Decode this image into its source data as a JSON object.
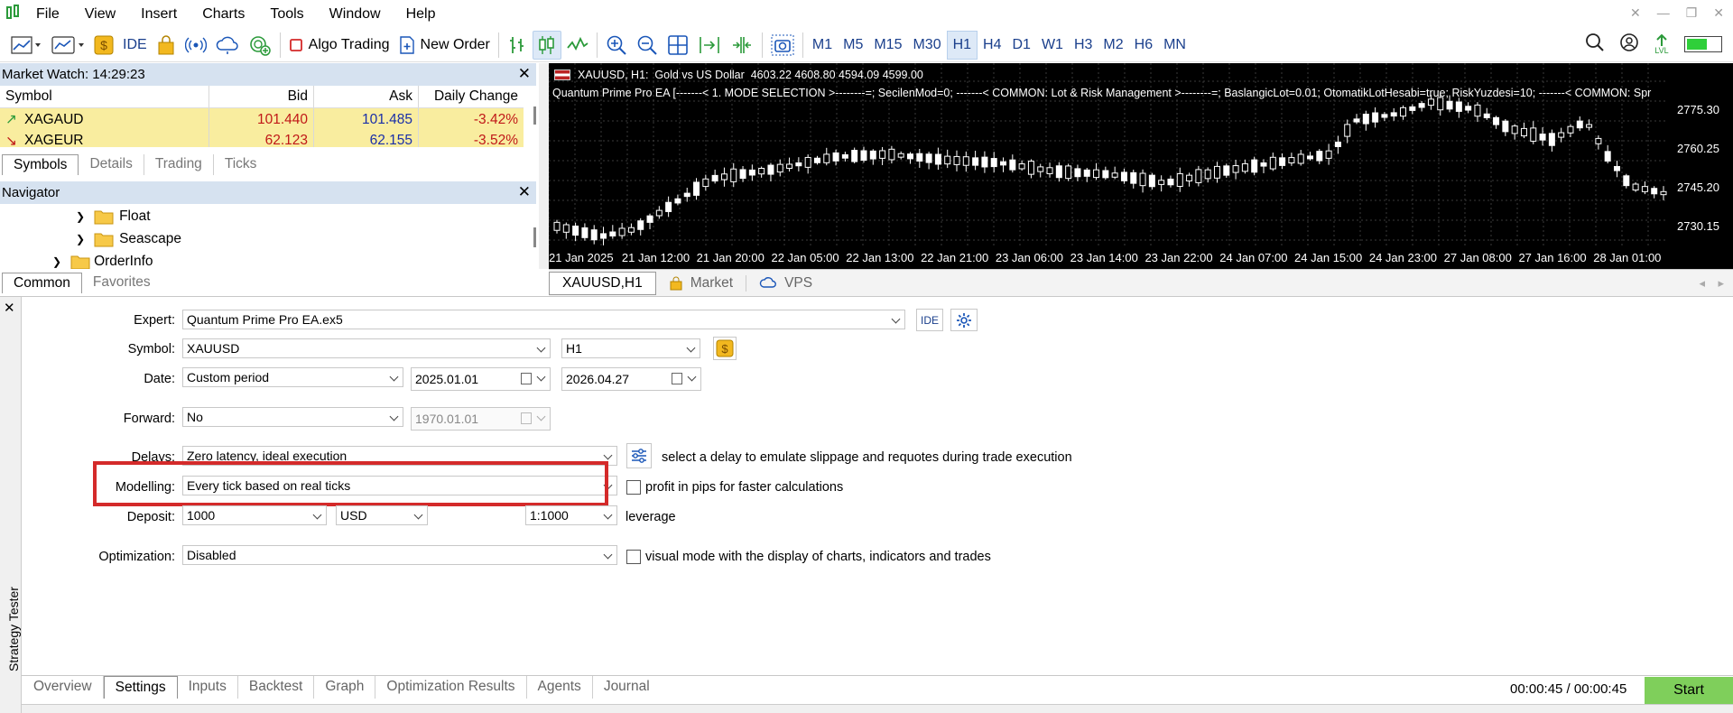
{
  "menu": [
    "File",
    "View",
    "Insert",
    "Charts",
    "Tools",
    "Window",
    "Help"
  ],
  "toolbar": {
    "algo_trading": "Algo Trading",
    "new_order": "New Order",
    "ide": "IDE",
    "timeframes": [
      "M1",
      "M5",
      "M15",
      "M30",
      "H1",
      "H4",
      "D1",
      "W1",
      "H3",
      "M2",
      "H6",
      "MN"
    ],
    "active_timeframe": "H1",
    "lvl": "LVL"
  },
  "market_watch": {
    "title": "Market Watch: 14:29:23",
    "columns": [
      "Symbol",
      "Bid",
      "Ask",
      "Daily Change"
    ],
    "rows": [
      {
        "symbol": "XAGAUD",
        "bid": "101.440",
        "ask": "101.485",
        "change": "-3.42%"
      },
      {
        "symbol": "XAGEUR",
        "bid": "62.123",
        "ask": "62.155",
        "change": "-3.52%"
      }
    ],
    "tabs": [
      "Symbols",
      "Details",
      "Trading",
      "Ticks"
    ]
  },
  "navigator": {
    "title": "Navigator",
    "items": [
      "Float",
      "Seascape",
      "OrderInfo"
    ],
    "tabs": [
      "Common",
      "Favorites"
    ]
  },
  "chart": {
    "header": "XAUUSD, H1:  Gold vs US Dollar  4603.22 4608.80 4594.09 4599.00",
    "ea_line": "Quantum Prime Pro EA [-------< 1. MODE SELECTION >--------=; SecilenMod=0; -------< COMMON: Lot & Risk Management >--------=; BaslangicLot=0.01; OtomatikLotHesabi=true; RiskYuzdesi=10; -------< COMMON: Spr",
    "price_labels": [
      "2775.30",
      "2760.25",
      "2745.20",
      "2730.15"
    ],
    "time_labels": [
      "21 Jan 2025",
      "21 Jan 12:00",
      "21 Jan 20:00",
      "22 Jan 05:00",
      "22 Jan 13:00",
      "22 Jan 21:00",
      "23 Jan 06:00",
      "23 Jan 14:00",
      "23 Jan 22:00",
      "24 Jan 07:00",
      "24 Jan 15:00",
      "24 Jan 23:00",
      "27 Jan 08:00",
      "27 Jan 16:00",
      "28 Jan 01:00"
    ],
    "tabs": [
      "XAUUSD,H1",
      "Market",
      "VPS"
    ],
    "colors": {
      "background": "#000000",
      "bull": "#ffffff",
      "bear": "#ffffff",
      "grid": "#3a3a3a"
    }
  },
  "tester": {
    "side_label": "Strategy Tester",
    "labels": {
      "expert": "Expert:",
      "symbol": "Symbol:",
      "date": "Date:",
      "forward": "Forward:",
      "delays": "Delays:",
      "modelling": "Modelling:",
      "deposit": "Deposit:",
      "optimization": "Optimization:"
    },
    "values": {
      "expert": "Quantum Prime Pro EA.ex5",
      "symbol": "XAUUSD",
      "period": "H1",
      "date_mode": "Custom period",
      "date_from": "2025.01.01",
      "date_to": "2026.04.27",
      "forward": "No",
      "forward_date": "1970.01.01",
      "delays": "Zero latency, ideal execution",
      "modelling": "Every tick based on real ticks",
      "deposit": "1000",
      "currency": "USD",
      "leverage": "1:1000",
      "optimization": "Disabled"
    },
    "ide_label": "IDE",
    "notes": {
      "delays": "select a delay to emulate slippage and requotes during trade execution",
      "profit_pips": "profit in pips for faster calculations",
      "leverage": "leverage",
      "visual": "visual mode with the display of charts, indicators and trades"
    },
    "tabs": [
      "Overview",
      "Settings",
      "Inputs",
      "Backtest",
      "Graph",
      "Optimization Results",
      "Agents",
      "Journal"
    ],
    "timer": "00:00:45 / 00:00:45",
    "start": "Start",
    "highlight_color": "#d42a2a"
  }
}
